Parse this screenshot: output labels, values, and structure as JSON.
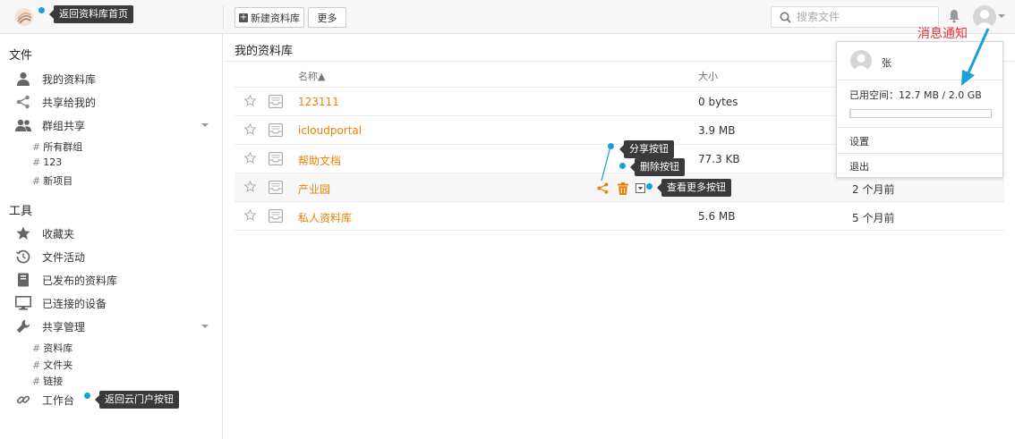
{
  "colors": {
    "accent_orange": "#eb8205",
    "annotation_blue": "#1b9fd8",
    "annotation_red": "#e0313b",
    "tooltip_bg": "#3a3a3a"
  },
  "topbar": {
    "new_library_label": "新建资料库",
    "more_label": "更多",
    "search_placeholder": "搜索文件"
  },
  "sidebar": {
    "files_section": "文件",
    "my_libraries": "我的资料库",
    "shared_with_me": "共享给我的",
    "group_share": "群组共享",
    "groups": [
      "所有群组",
      "123",
      "新项目"
    ],
    "tools_section": "工具",
    "favorites": "收藏夹",
    "file_activity": "文件活动",
    "published_libraries": "已发布的资料库",
    "linked_devices": "已连接的设备",
    "share_admin": "共享管理",
    "share_admin_items": [
      "资料库",
      "文件夹",
      "链接"
    ],
    "workbench": "工作台",
    "hash": "#"
  },
  "main": {
    "title": "我的资料库",
    "columns": {
      "name": "名称▲",
      "size": "大小"
    },
    "rows": [
      {
        "name": "123111",
        "size": "0 bytes",
        "mtime": ""
      },
      {
        "name": "icloudportal",
        "size": "3.9 MB",
        "mtime": ""
      },
      {
        "name": "帮助文档",
        "size": "77.3 KB",
        "mtime": ""
      },
      {
        "name": "产业园",
        "size": "",
        "mtime": "2 个月前"
      },
      {
        "name": "私人资料库",
        "size": "5.6 MB",
        "mtime": "5 个月前"
      }
    ]
  },
  "annotations": {
    "back_to_home": "返回资料库首页",
    "share_button": "分享按钮",
    "delete_button": "删除按钮",
    "more_button": "查看更多按钮",
    "back_to_portal": "返回云门户按钮",
    "notification": "消息通知"
  },
  "popup": {
    "user_name": "张",
    "quota_label": "已用空间：",
    "quota_value": "12.7 MB / 2.0 GB",
    "quota_fraction": 0.006,
    "settings": "设置",
    "logout": "退出"
  }
}
